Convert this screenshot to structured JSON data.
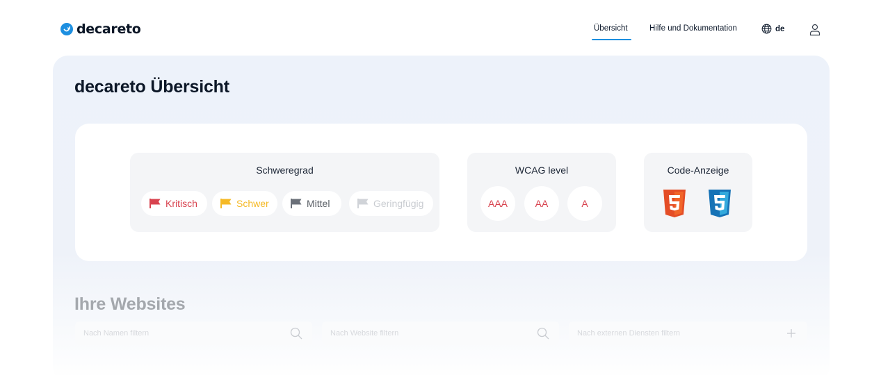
{
  "header": {
    "logo_text": "decareto",
    "nav": {
      "overview": "Übersicht",
      "help": "Hilfe und Dokumentation"
    },
    "language": "de"
  },
  "page_title": "decareto Übersicht",
  "filters": {
    "severity": {
      "title": "Schweregrad",
      "items": [
        {
          "label": "Kritisch",
          "color": "#d8434f"
        },
        {
          "label": "Schwer",
          "color": "#f5b925"
        },
        {
          "label": "Mittel",
          "color": "#5a5f66"
        },
        {
          "label": "Geringfügig",
          "color": "#c9ccd1"
        }
      ]
    },
    "wcag": {
      "title": "WCAG level",
      "levels": [
        "AAA",
        "AA",
        "A"
      ]
    },
    "code": {
      "title": "Code-Anzeige",
      "icons": [
        "html5-icon",
        "css3-icon"
      ]
    }
  },
  "websites": {
    "title": "Ihre Websites",
    "filters": [
      {
        "placeholder": "Nach Namen filtern",
        "icon": "search-icon"
      },
      {
        "placeholder": "Nach Website filtern",
        "icon": "search-icon"
      },
      {
        "placeholder": "Nach externen Diensten filtern",
        "icon": "plus-icon"
      }
    ]
  },
  "colors": {
    "accent": "#1d8fe0",
    "panel_bg": "#edf2fa"
  }
}
